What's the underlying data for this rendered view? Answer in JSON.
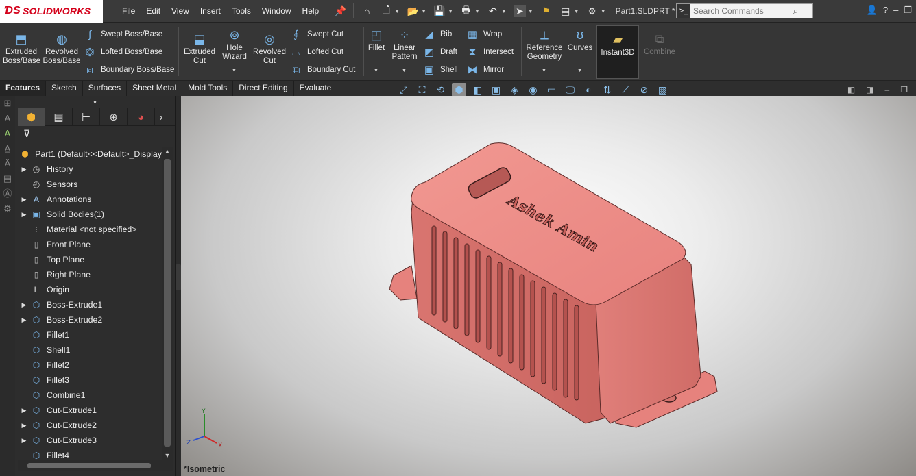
{
  "app": {
    "brand": "SOLIDWORKS",
    "menu": [
      "File",
      "Edit",
      "View",
      "Insert",
      "Tools",
      "Window",
      "Help"
    ],
    "document_title": "Part1.SLDPRT *",
    "search_placeholder": "Search Commands"
  },
  "commands": {
    "extruded_boss": "Extruded\nBoss/Base",
    "revolved_boss": "Revolved\nBoss/Base",
    "swept_boss": "Swept Boss/Base",
    "lofted_boss": "Lofted Boss/Base",
    "boundary_boss": "Boundary Boss/Base",
    "extruded_cut": "Extruded\nCut",
    "hole_wizard": "Hole\nWizard",
    "revolved_cut": "Revolved\nCut",
    "swept_cut": "Swept Cut",
    "lofted_cut": "Lofted Cut",
    "boundary_cut": "Boundary Cut",
    "fillet": "Fillet",
    "linear_pattern": "Linear\nPattern",
    "rib": "Rib",
    "draft": "Draft",
    "shell": "Shell",
    "wrap": "Wrap",
    "intersect": "Intersect",
    "mirror": "Mirror",
    "reference_geometry": "Reference\nGeometry",
    "curves": "Curves",
    "instant3d": "Instant3D",
    "combine": "Combine"
  },
  "tabs": [
    "Features",
    "Sketch",
    "Surfaces",
    "Sheet Metal",
    "Mold Tools",
    "Direct Editing",
    "Evaluate"
  ],
  "tree": {
    "root": "Part1  (Default<<Default>_Display",
    "items": [
      {
        "label": "History",
        "expandable": true
      },
      {
        "label": "Sensors",
        "expandable": false
      },
      {
        "label": "Annotations",
        "expandable": true
      },
      {
        "label": "Solid Bodies(1)",
        "expandable": true
      },
      {
        "label": "Material <not specified>",
        "expandable": false
      },
      {
        "label": "Front Plane",
        "expandable": false
      },
      {
        "label": "Top Plane",
        "expandable": false
      },
      {
        "label": "Right Plane",
        "expandable": false
      },
      {
        "label": "Origin",
        "expandable": false
      },
      {
        "label": "Boss-Extrude1",
        "expandable": true
      },
      {
        "label": "Boss-Extrude2",
        "expandable": true
      },
      {
        "label": "Fillet1",
        "expandable": false
      },
      {
        "label": "Shell1",
        "expandable": false
      },
      {
        "label": "Fillet2",
        "expandable": false
      },
      {
        "label": "Fillet3",
        "expandable": false
      },
      {
        "label": "Combine1",
        "expandable": false
      },
      {
        "label": "Cut-Extrude1",
        "expandable": true
      },
      {
        "label": "Cut-Extrude2",
        "expandable": true
      },
      {
        "label": "Cut-Extrude3",
        "expandable": true
      },
      {
        "label": "Fillet4",
        "expandable": false
      }
    ]
  },
  "viewport": {
    "view_name": "*Isometric",
    "engraving": "Ashek Amin",
    "model_color": "#e8837f",
    "triad": {
      "x": "X",
      "y": "Y",
      "z": "Z"
    }
  }
}
